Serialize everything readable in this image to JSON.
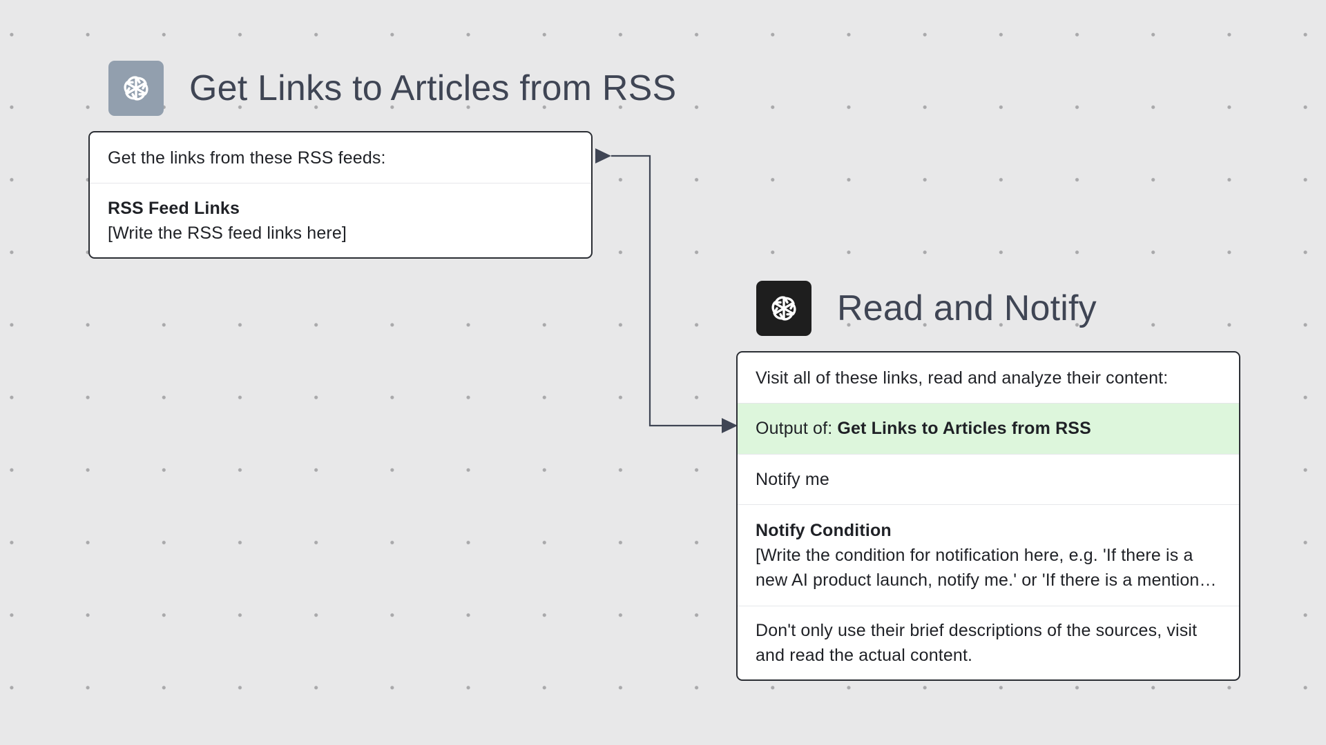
{
  "nodes": [
    {
      "title": "Get Links to Articles from RSS",
      "icon": "openai-icon",
      "icon_bg": "#929fae",
      "prompt": "Get the links from these RSS feeds:",
      "field": {
        "label": "RSS Feed Links",
        "value": "[Write the RSS feed links here]"
      }
    },
    {
      "title": "Read and Notify",
      "icon": "openai-icon",
      "icon_bg": "#1e1e1e",
      "prompt": "Visit all of these links, read and analyze their content:",
      "output_ref": {
        "prefix": "Output of: ",
        "source": "Get Links to Articles from RSS"
      },
      "notify_text": "Notify me",
      "condition": {
        "label": "Notify Condition",
        "line1": "[Write the condition for notification here, e.g. 'If there is a",
        "line2": "new AI product launch, notify me.' or 'If there is a mention of a specific company, notify me.']"
      },
      "note": "Don't only use their brief descriptions of the sources, visit and read the actual content."
    }
  ],
  "colors": {
    "canvas": "#e8e8e9",
    "connector": "#3f4554",
    "output_highlight": "#ddf6dc"
  }
}
